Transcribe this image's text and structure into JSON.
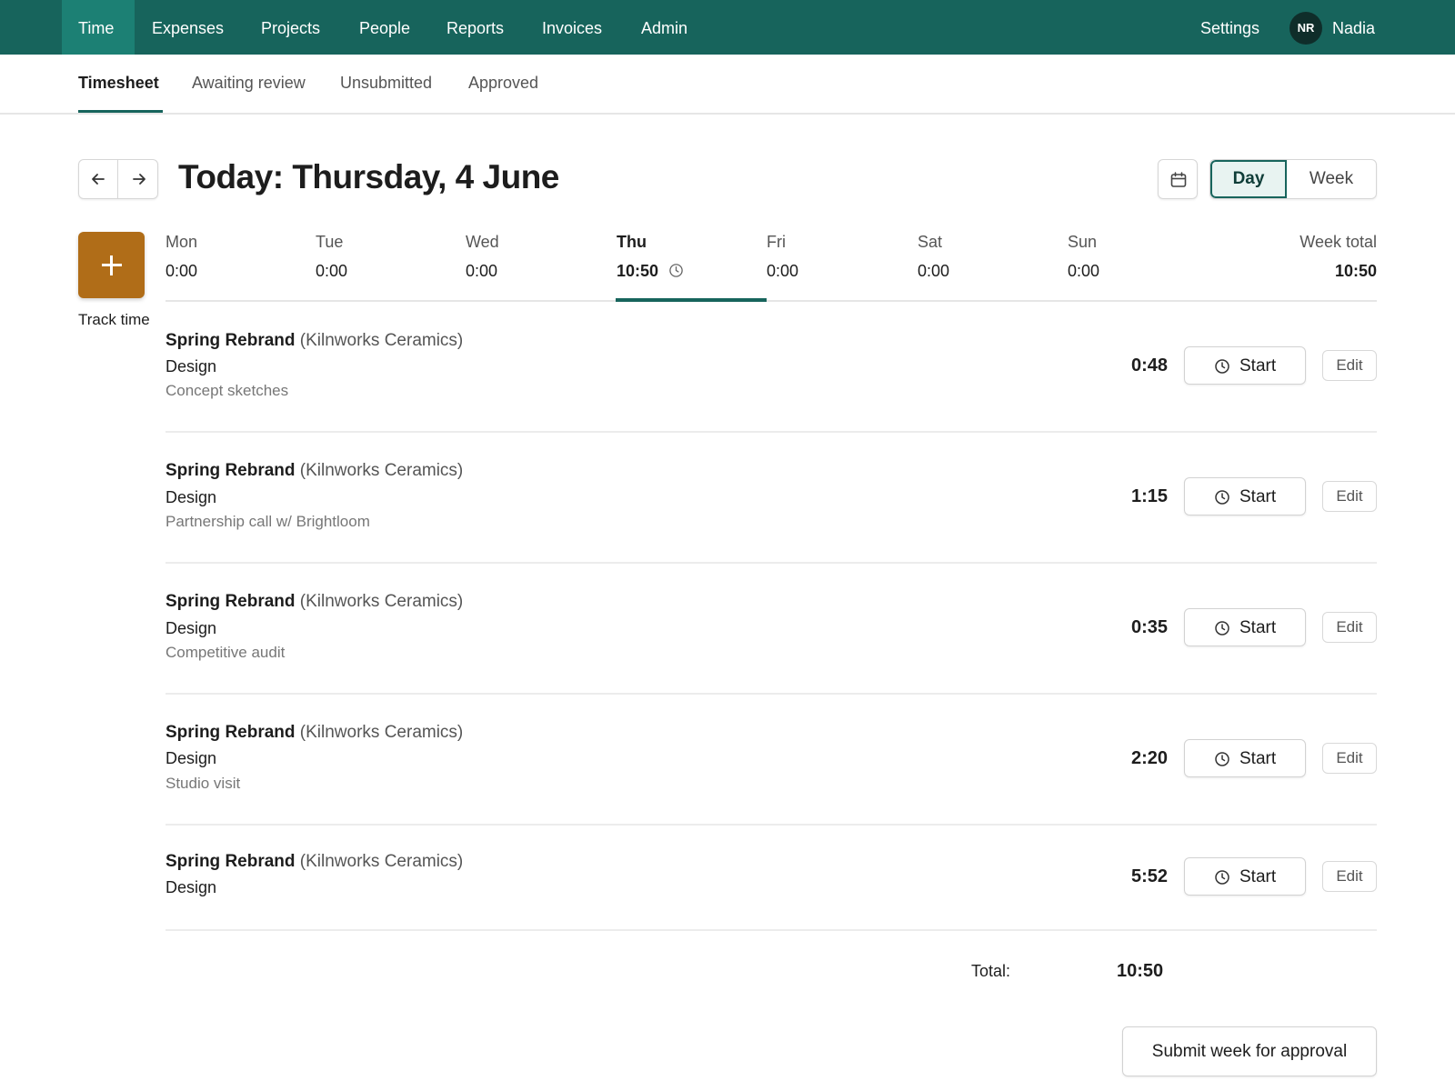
{
  "nav": {
    "items": [
      {
        "label": "Time"
      },
      {
        "label": "Expenses"
      },
      {
        "label": "Projects"
      },
      {
        "label": "People"
      },
      {
        "label": "Reports"
      },
      {
        "label": "Invoices"
      },
      {
        "label": "Admin"
      }
    ],
    "active": "Time",
    "settings_label": "Settings",
    "user_initials": "NR",
    "user_name": "Nadia"
  },
  "subtabs": {
    "items": [
      {
        "label": "Timesheet"
      },
      {
        "label": "Awaiting review"
      },
      {
        "label": "Unsubmitted"
      },
      {
        "label": "Approved"
      }
    ],
    "active": "Timesheet"
  },
  "header": {
    "prev_icon": "arrow-left-icon",
    "next_icon": "arrow-right-icon",
    "title": "Today: Thursday, 4 June",
    "calendar_icon": "calendar-icon",
    "view_day": "Day",
    "view_week": "Week",
    "active_view": "Day"
  },
  "track": {
    "icon": "plus-icon",
    "label": "Track time"
  },
  "days": [
    {
      "name": "Mon",
      "value": "0:00"
    },
    {
      "name": "Tue",
      "value": "0:00"
    },
    {
      "name": "Wed",
      "value": "0:00"
    },
    {
      "name": "Thu",
      "value": "10:50",
      "today": true
    },
    {
      "name": "Fri",
      "value": "0:00"
    },
    {
      "name": "Sat",
      "value": "0:00"
    },
    {
      "name": "Sun",
      "value": "0:00"
    }
  ],
  "week_total": {
    "label": "Week total",
    "value": "10:50"
  },
  "entries": [
    {
      "project": "Spring Rebrand",
      "client": "(Kilnworks Ceramics)",
      "task": "Design",
      "note": "Concept sketches",
      "duration": "0:48",
      "start_label": "Start",
      "edit_label": "Edit"
    },
    {
      "project": "Spring Rebrand",
      "client": "(Kilnworks Ceramics)",
      "task": "Design",
      "note": "Partnership call w/ Brightloom",
      "duration": "1:15",
      "start_label": "Start",
      "edit_label": "Edit"
    },
    {
      "project": "Spring Rebrand",
      "client": "(Kilnworks Ceramics)",
      "task": "Design",
      "note": "Competitive audit",
      "duration": "0:35",
      "start_label": "Start",
      "edit_label": "Edit"
    },
    {
      "project": "Spring Rebrand",
      "client": "(Kilnworks Ceramics)",
      "task": "Design",
      "note": "Studio visit",
      "duration": "2:20",
      "start_label": "Start",
      "edit_label": "Edit"
    },
    {
      "project": "Spring Rebrand",
      "client": "(Kilnworks Ceramics)",
      "task": "Design",
      "note": "",
      "duration": "5:52",
      "start_label": "Start",
      "edit_label": "Edit"
    }
  ],
  "totals": {
    "label": "Total:",
    "value": "10:50"
  },
  "submit_label": "Submit week for approval",
  "colors": {
    "nav_bg": "#17645c",
    "nav_active": "#1c8074",
    "accent": "#17645c",
    "track_button": "#b06d18"
  }
}
